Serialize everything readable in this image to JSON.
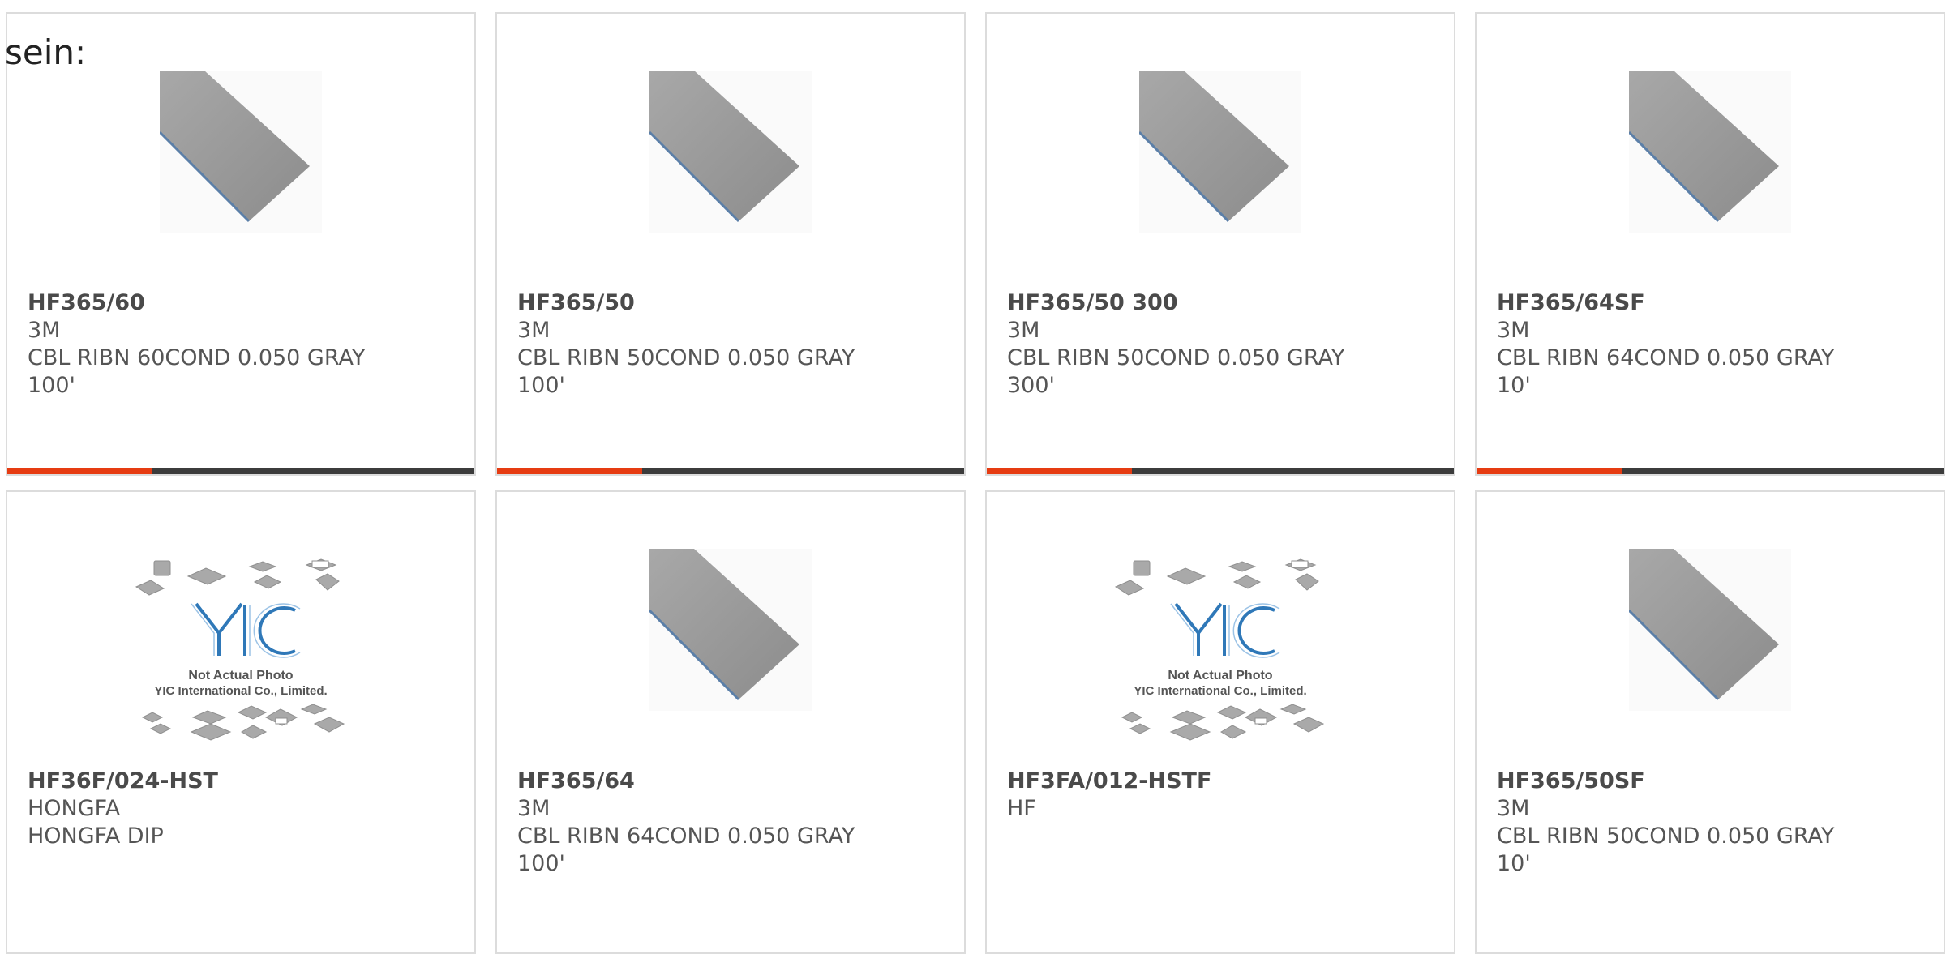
{
  "partial_text": "sein:",
  "colors": {
    "accent": "#e63c12",
    "bar_track": "#3c3c3c",
    "card_border": "#dcdcdc",
    "text": "#555555"
  },
  "products": [
    {
      "part_number": "HF365/60",
      "manufacturer": "3M",
      "description": "CBL RIBN 60COND 0.050 GRAY",
      "extra": "100'",
      "image": "ribbon-cable-photo",
      "progress": 0.31
    },
    {
      "part_number": "HF365/50",
      "manufacturer": "3M",
      "description": "CBL RIBN 50COND 0.050 GRAY",
      "extra": "100'",
      "image": "ribbon-cable-photo",
      "progress": 0.31
    },
    {
      "part_number": "HF365/50 300",
      "manufacturer": "3M",
      "description": "CBL RIBN 50COND 0.050 GRAY",
      "extra": "300'",
      "image": "ribbon-cable-photo",
      "progress": 0.31
    },
    {
      "part_number": "HF365/64SF",
      "manufacturer": "3M",
      "description": "CBL RIBN 64COND 0.050 GRAY",
      "extra": "10'",
      "image": "ribbon-cable-photo",
      "progress": 0.31
    },
    {
      "part_number": "HF36F/024-HST",
      "manufacturer": "HONGFA",
      "description": "HONGFA DIP",
      "extra": "",
      "image": "not-actual-photo-placeholder",
      "placeholder_caption_1": "Not Actual Photo",
      "placeholder_caption_2": "YIC International Co., Limited.",
      "progress": null
    },
    {
      "part_number": "HF365/64",
      "manufacturer": "3M",
      "description": "CBL RIBN 64COND 0.050 GRAY",
      "extra": "100'",
      "image": "ribbon-cable-photo",
      "progress": null
    },
    {
      "part_number": "HF3FA/012-HSTF",
      "manufacturer": "HF",
      "description": "",
      "extra": "",
      "image": "not-actual-photo-placeholder",
      "placeholder_caption_1": "Not Actual Photo",
      "placeholder_caption_2": "YIC International Co., Limited.",
      "progress": null
    },
    {
      "part_number": "HF365/50SF",
      "manufacturer": "3M",
      "description": "CBL RIBN 50COND 0.050 GRAY",
      "extra": "10'",
      "image": "ribbon-cable-photo",
      "progress": null
    }
  ]
}
